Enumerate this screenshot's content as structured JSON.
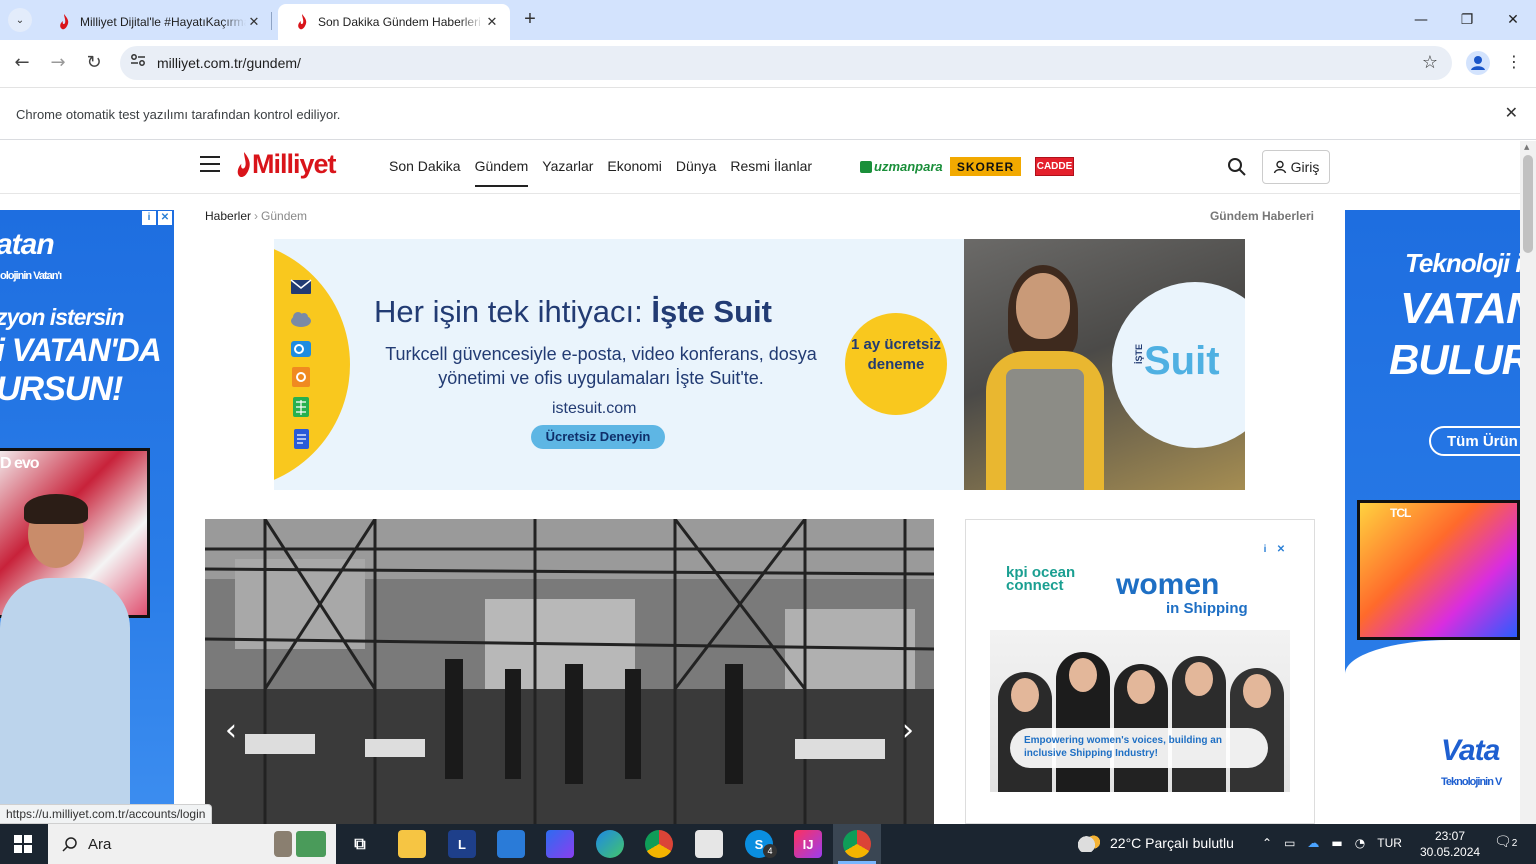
{
  "browser": {
    "tab_inactive": {
      "title": "Milliyet Dijital'le #HayatıKaçırma"
    },
    "tab_active": {
      "title": "Son Dakika Gündem Haberleri"
    },
    "new_tab": "+",
    "url": "milliyet.com.tr/gundem/",
    "infobar_text": "Chrome otomatik test yazılımı tarafından kontrol ediliyor.",
    "status_link": "https://u.milliyet.com.tr/accounts/login",
    "accent": "#d3e3fd"
  },
  "site": {
    "logo": "Milliyet",
    "brand_color": "#d9141a",
    "nav": [
      "Son Dakika",
      "Gündem",
      "Yazarlar",
      "Ekonomi",
      "Dünya",
      "Resmi İlanlar"
    ],
    "active_nav": "Gündem",
    "partners": {
      "uzmanpara": "uzmanpara",
      "skorer": "SKORER",
      "cadde": "CADDE"
    },
    "login": "Giriş",
    "breadcrumb": {
      "home": "Haberler",
      "current": "Gündem"
    },
    "section_title": "Gündem Haberleri"
  },
  "ads": {
    "left": {
      "logo": "atan",
      "tag": "olojinin Vatan'ı",
      "line1": "zyon istersin",
      "line2": "i VATAN'DA",
      "line3": "URSUN!",
      "model": "D evo"
    },
    "right": {
      "line1": "Teknoloji is",
      "line2": "VATAN",
      "line3": "BULURS",
      "button": "Tüm Ürün",
      "brand": "TCL",
      "logo": "Vata",
      "tag": "Teknolojinin V"
    },
    "banner": {
      "headline_pre": "Her işin tek ihtiyacı: ",
      "headline_bold": "İşte Suit",
      "sub": "Turkcell güvencesiyle e-posta, video konferans, dosya yönetimi ve ofis uygulamaları İşte Suit'te.",
      "url": "istesuit.com",
      "cta": "Ücretsiz Deneyin",
      "badge": "1 ay ücretsiz deneme",
      "brand": "Suit",
      "brand_prefix": "İŞTE"
    },
    "box": {
      "kpi": "kpi ocean connect",
      "women": "women",
      "shipping": "in Shipping",
      "tagline": "Empowering women's voices, building an inclusive Shipping Industry!"
    }
  },
  "taskbar": {
    "search": "Ara",
    "weather": "22°C  Parçalı bulutlu",
    "lang": "TUR",
    "time": "23:07",
    "date": "30.05.2024",
    "notif_count": "2",
    "skype_badge": "4"
  }
}
